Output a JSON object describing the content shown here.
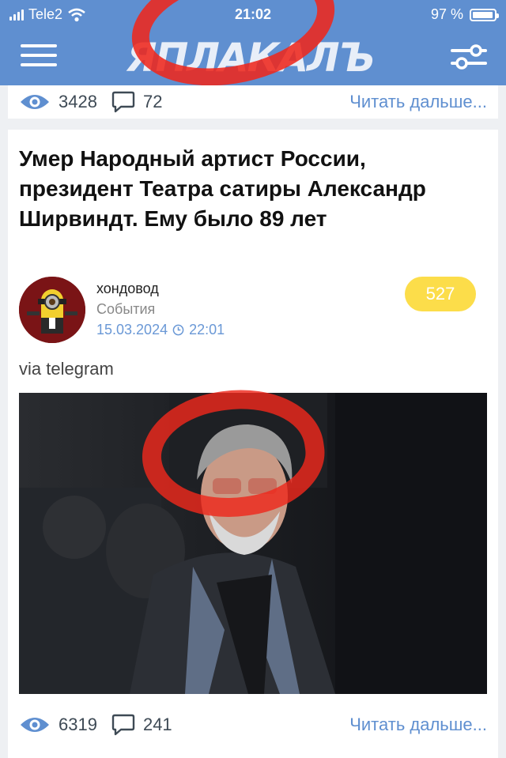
{
  "status_bar": {
    "carrier": "Tele2",
    "time": "21:02",
    "battery": "97 %",
    "battery_level": 0.97
  },
  "header": {
    "logo": "ЯПЛАКАЛЪ"
  },
  "previous_post": {
    "views": "3428",
    "comments": "72",
    "read_more": "Читать дальше..."
  },
  "post": {
    "title": "Умер Народный артист России, президент Театра сатиры Александр Ширвиндт. Ему было 89 лет",
    "author": "хондовод",
    "category": "События",
    "date": "15.03.2024",
    "time": "22:01",
    "score": "527",
    "source": "via telegram",
    "views": "6319",
    "comments": "241",
    "read_more": "Читать дальше..."
  },
  "colors": {
    "header": "#5f8fd0",
    "link": "#5f8fd0",
    "score_badge": "#fcdd4a",
    "scribble": "#ee281c"
  },
  "icons": [
    "signal-icon",
    "wifi-icon",
    "battery-icon",
    "menu-icon",
    "filter-icon",
    "eye-icon",
    "comment-icon",
    "clock-icon"
  ]
}
